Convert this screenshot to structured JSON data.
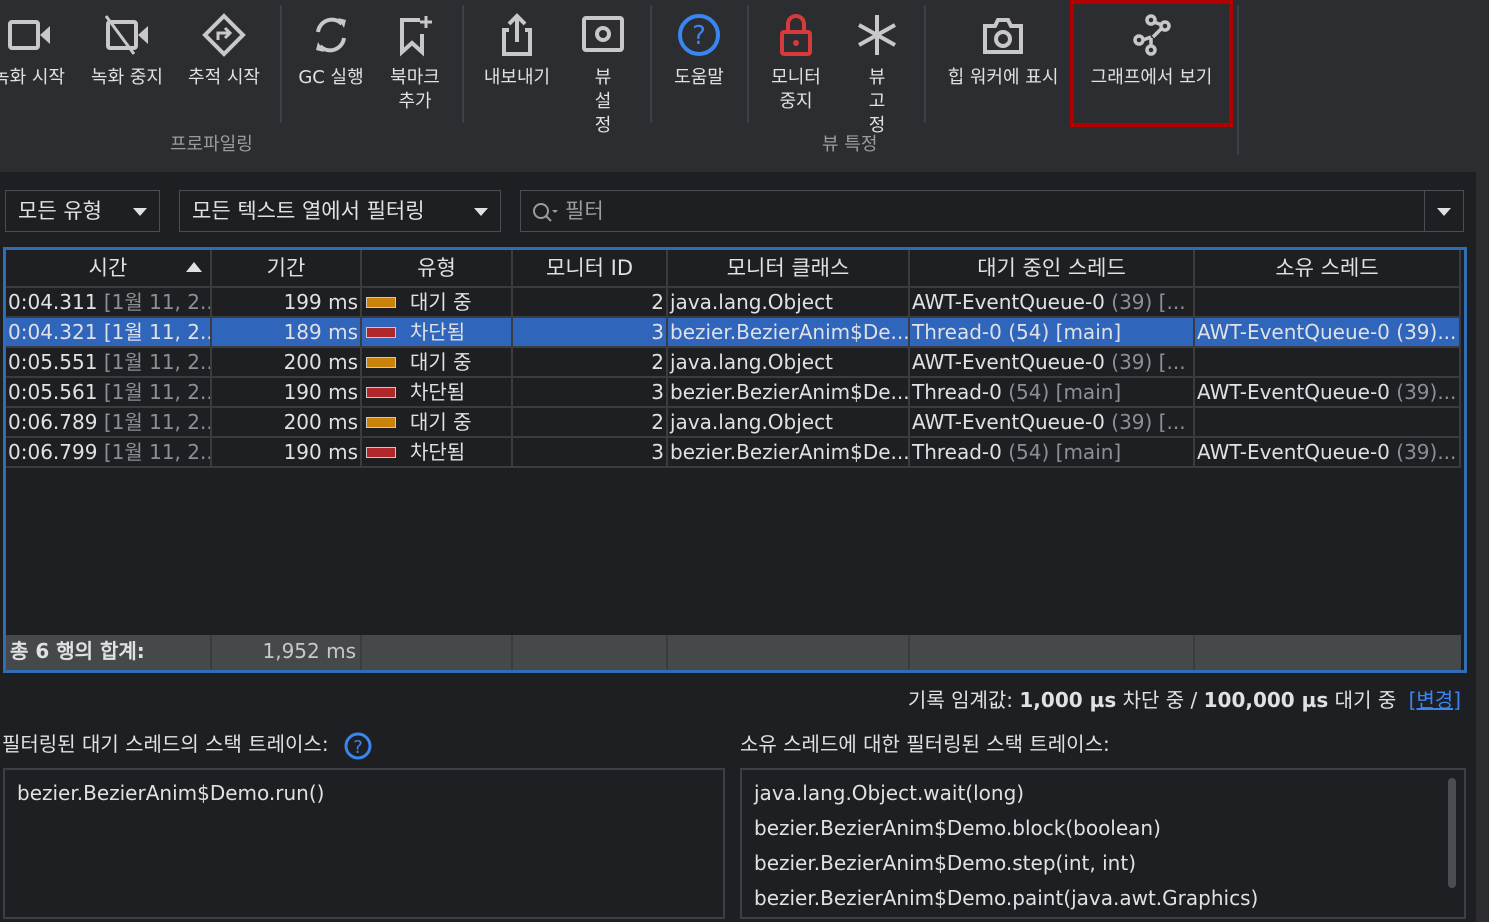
{
  "toolbar": {
    "buttons": [
      {
        "label": "녹화 시작",
        "icon": "video-camera-icon"
      },
      {
        "label": "녹화 중지",
        "icon": "video-off-icon"
      },
      {
        "label": "추적 시작",
        "icon": "trace-diamond-icon"
      },
      {
        "label": "GC 실행",
        "icon": "refresh-icon"
      },
      {
        "label": "북마크 추가",
        "icon": "bookmark-add-icon"
      },
      {
        "label": "내보내기",
        "icon": "export-icon"
      },
      {
        "label": "뷰 설정",
        "icon": "settings-icon"
      },
      {
        "label": "도움말",
        "icon": "help-icon"
      },
      {
        "label": "모니터 중지",
        "icon": "lock-icon"
      },
      {
        "label": "뷰 고정",
        "icon": "snowflake-icon"
      },
      {
        "label": "힙 워커에 표시",
        "icon": "camera-icon"
      },
      {
        "label": "그래프에서 보기",
        "icon": "graph-icon"
      }
    ],
    "groups": {
      "profiling": "프로파일링",
      "view_specific": "뷰 특정"
    },
    "highlight_color": "#b00000"
  },
  "filters": {
    "type": "모든 유형",
    "columns": "모든 텍스트 열에서 필터링",
    "search_placeholder": "필터"
  },
  "table": {
    "columns": [
      "시간",
      "기간",
      "유형",
      "모니터 ID",
      "모니터 클래스",
      "대기 중인 스레드",
      "소유 스레드"
    ],
    "rows": [
      {
        "time": "0:04.311",
        "date": "[1월 11, 2...",
        "duration": "199 ms",
        "type": "대기 중",
        "color": "#c9830a",
        "id": "2",
        "cls": "java.lang.Object",
        "wait": "AWT-EventQueue-0",
        "wait_extra": "(39) [...",
        "owner": "",
        "owner_extra": ""
      },
      {
        "time": "0:04.321",
        "date": "[1월 11, 2...",
        "duration": "189 ms",
        "type": "차단됨",
        "color": "#b0272a",
        "id": "3",
        "cls": "bezier.BezierAnim$De...",
        "wait": "Thread-0",
        "wait_extra": "(54) [main]",
        "owner": "AWT-EventQueue-0",
        "owner_extra": "(39)..."
      },
      {
        "time": "0:05.551",
        "date": "[1월 11, 2...",
        "duration": "200 ms",
        "type": "대기 중",
        "color": "#c9830a",
        "id": "2",
        "cls": "java.lang.Object",
        "wait": "AWT-EventQueue-0",
        "wait_extra": "(39) [...",
        "owner": "",
        "owner_extra": ""
      },
      {
        "time": "0:05.561",
        "date": "[1월 11, 2...",
        "duration": "190 ms",
        "type": "차단됨",
        "color": "#b0272a",
        "id": "3",
        "cls": "bezier.BezierAnim$De...",
        "wait": "Thread-0",
        "wait_extra": "(54) [main]",
        "owner": "AWT-EventQueue-0",
        "owner_extra": "(39)..."
      },
      {
        "time": "0:06.789",
        "date": "[1월 11, 2...",
        "duration": "200 ms",
        "type": "대기 중",
        "color": "#c9830a",
        "id": "2",
        "cls": "java.lang.Object",
        "wait": "AWT-EventQueue-0",
        "wait_extra": "(39) [...",
        "owner": "",
        "owner_extra": ""
      },
      {
        "time": "0:06.799",
        "date": "[1월 11, 2...",
        "duration": "190 ms",
        "type": "차단됨",
        "color": "#b0272a",
        "id": "3",
        "cls": "bezier.BezierAnim$De...",
        "wait": "Thread-0",
        "wait_extra": "(54) [main]",
        "owner": "AWT-EventQueue-0",
        "owner_extra": "(39)..."
      }
    ],
    "selected_index": 1,
    "footer": {
      "label": "총 6 행의 합계:",
      "total": "1,952 ms"
    }
  },
  "threshold": {
    "prefix": "기록 임계값:",
    "blocked_value": "1,000 µs",
    "blocked_label": "차단 중 /",
    "waiting_value": "100,000 µs",
    "waiting_label": "대기 중",
    "change_link": "[변경]"
  },
  "stacks": {
    "left_title": "필터링된 대기 스레드의 스택 트레이스:",
    "right_title": "소유 스레드에 대한 필터링된 스택 트레이스:",
    "left": [
      "bezier.BezierAnim$Demo.run()"
    ],
    "right": [
      "java.lang.Object.wait(long)",
      "bezier.BezierAnim$Demo.block(boolean)",
      "bezier.BezierAnim$Demo.step(int, int)",
      "bezier.BezierAnim$Demo.paint(java.awt.Graphics)"
    ]
  }
}
